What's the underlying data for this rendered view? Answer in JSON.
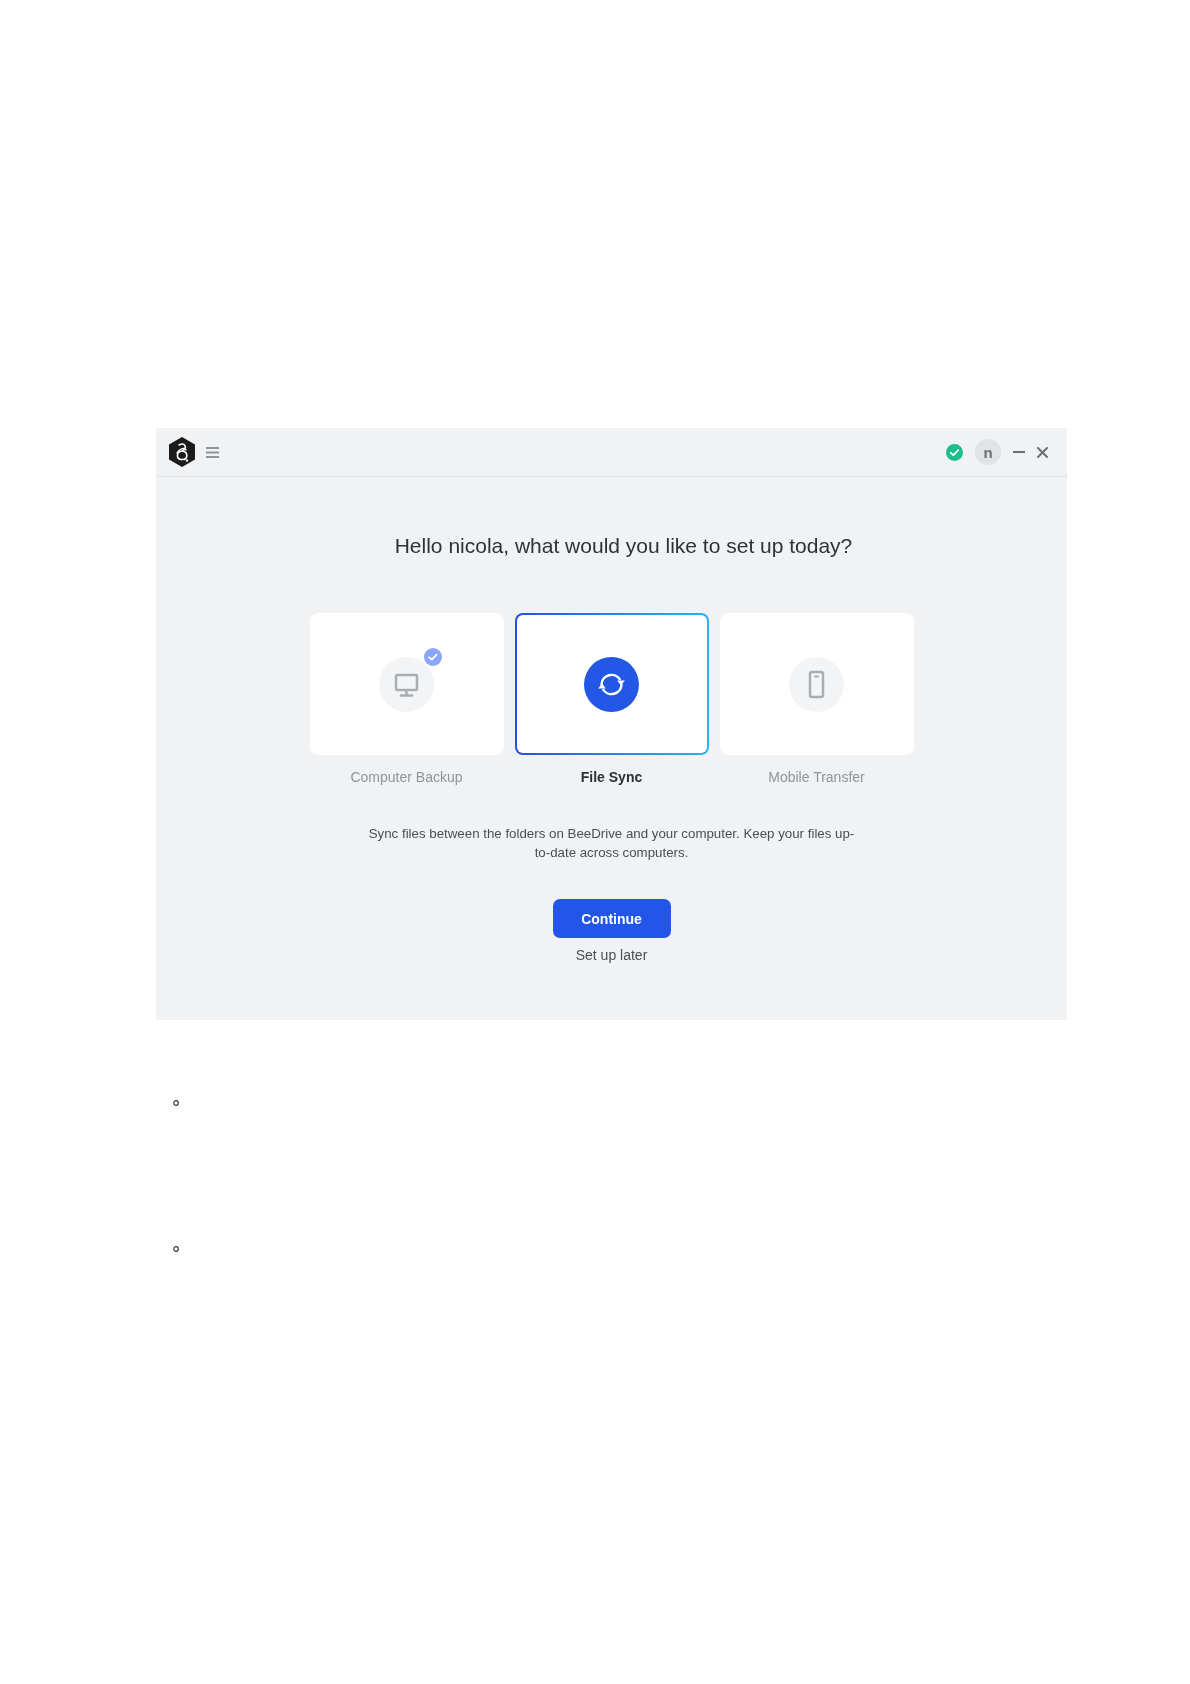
{
  "title_bar": {
    "avatar_initial": "n"
  },
  "heading": "Hello nicola, what would you like to set up today?",
  "options": [
    {
      "label": "Computer Backup",
      "selected": false,
      "checked": true
    },
    {
      "label": "File Sync",
      "selected": true,
      "checked": false
    },
    {
      "label": "Mobile Transfer",
      "selected": false,
      "checked": false
    }
  ],
  "description": "Sync files between the folders on BeeDrive and your computer. Keep your files up-to-date across computers.",
  "primary_button": "Continue",
  "secondary_link": "Set up later",
  "page_list": [
    {
      "kind": "bullet"
    },
    {
      "kind": "bullet"
    }
  ]
}
